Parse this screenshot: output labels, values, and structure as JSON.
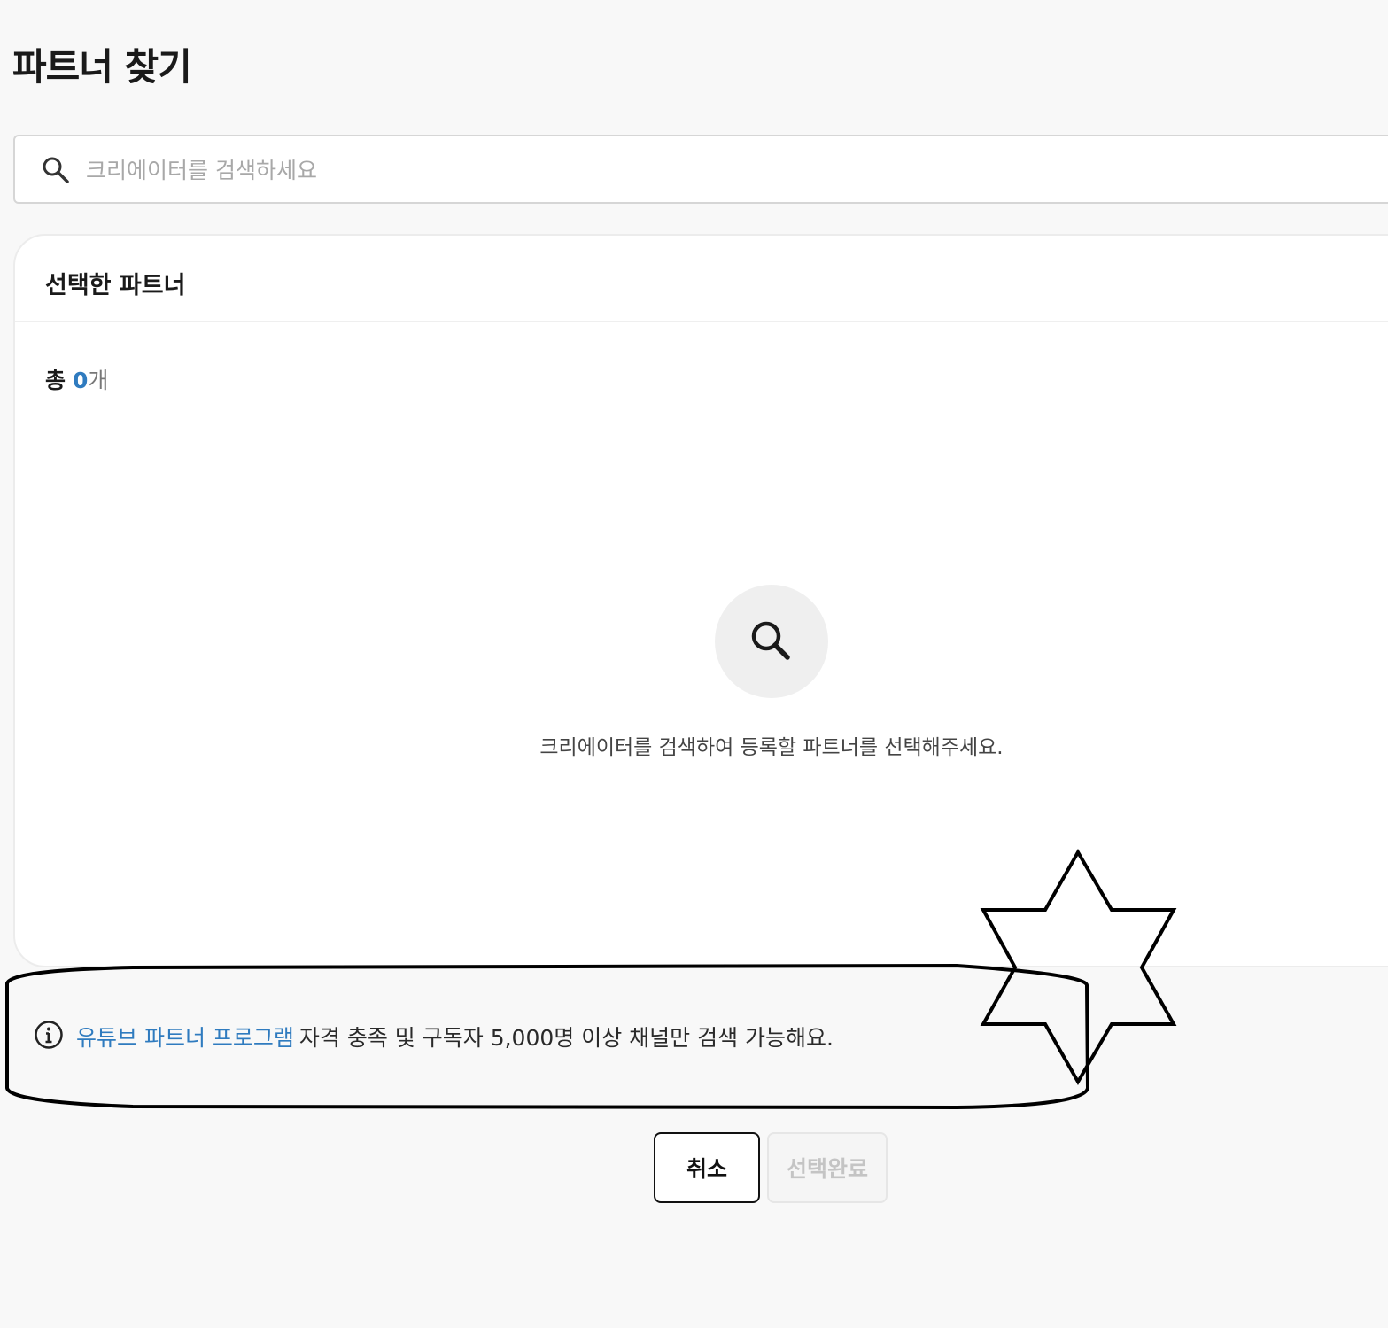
{
  "page": {
    "title": "파트너 찾기"
  },
  "search": {
    "placeholder": "크리에이터를 검색하세요",
    "icon": "search-icon"
  },
  "selected_panel": {
    "title": "선택한 파트너",
    "count_label": "총",
    "count_value": "0",
    "count_unit": "개",
    "empty_icon": "search-icon",
    "empty_message": "크리에이터를 검색하여 등록할 파트너를 선택해주세요."
  },
  "notice": {
    "icon": "info-icon",
    "link_text": "유튜브 파트너 프로그램",
    "text": "자격 충족 및 구독자 5,000명 이상 채널만 검색 가능해요."
  },
  "actions": {
    "cancel_label": "취소",
    "done_label": "선택완료"
  },
  "colors": {
    "accent": "#2f7bbf",
    "background": "#f8f8f8",
    "panel": "#ffffff",
    "disabled_text": "#c4c4c4"
  }
}
